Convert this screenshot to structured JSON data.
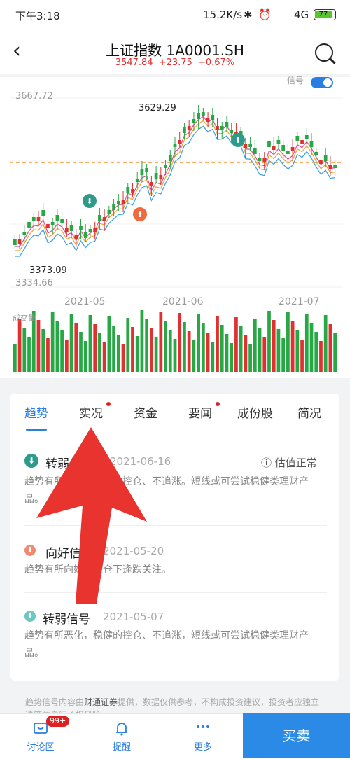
{
  "status": {
    "time": "下午3:18",
    "speed": "15.2K/s",
    "network": "4G",
    "battery": "77"
  },
  "header": {
    "title": "上证指数  1A0001.SH",
    "price": "3547.84",
    "change": "+23.75",
    "pct": "+0.67%"
  },
  "toggle_label": "信号",
  "chart": {
    "y_top": "3667.72",
    "y_bottom": "3334.66",
    "high_label": "3629.29",
    "low_label": "3373.09",
    "x_labels": [
      "2021-05",
      "2021-06",
      "2021-07"
    ],
    "volume_label": "成交量"
  },
  "tabs": [
    {
      "label": "趋势",
      "active": true
    },
    {
      "label": "实况",
      "dot": true
    },
    {
      "label": "资金"
    },
    {
      "label": "要闻",
      "dot": true
    },
    {
      "label": "成份股"
    },
    {
      "label": "简况"
    }
  ],
  "signals": [
    {
      "title": "转弱信号",
      "date": "2021-06-16",
      "note": "估值正常",
      "desc": "趋势有所恶化，稳健的控仓、不追涨。短线或可尝试稳健类理财产品。",
      "type": "down"
    },
    {
      "title": "向好信号",
      "date": "2021-05-20",
      "desc": "趋势有所向好，控仓下逢跌关注。",
      "type": "up"
    },
    {
      "title": "转弱信号",
      "date": "2021-05-07",
      "desc": "趋势有所恶化，稳健的控仓、不追涨，短线或可尝试稳健类理财产品。",
      "type": "down"
    }
  ],
  "footnote": {
    "prefix": "趋势信号内容由",
    "brand": "财通证券",
    "suffix": "提供，数据仅供参考，不构成投资建议，投资者应独立决策并自行承担风险"
  },
  "bottom": {
    "discuss": "讨论区",
    "badge": "99+",
    "remind": "提醒",
    "more": "更多",
    "buy": "买卖"
  },
  "colors": {
    "up": "#e03030",
    "down": "#28a745",
    "accent": "#2a7de1"
  }
}
